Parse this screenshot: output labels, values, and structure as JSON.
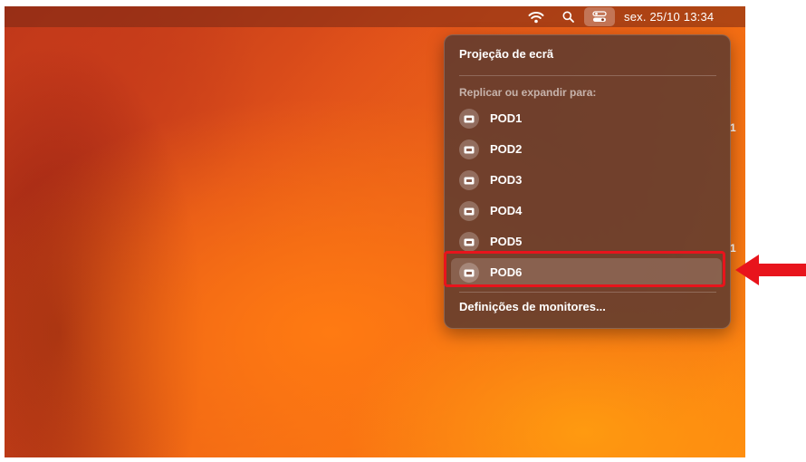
{
  "colors": {
    "annotation": "#e8141c",
    "panel_bg": "#5c3a30",
    "text": "#ffffff"
  },
  "menubar": {
    "icons": [
      "wifi-icon",
      "search-icon",
      "control-center-icon"
    ],
    "clock": "sex. 25/10  13:34"
  },
  "desktop": {
    "edge_digits": [
      "1",
      "1"
    ]
  },
  "screen_mirroring": {
    "title": "Projeção de ecrã",
    "section_label": "Replicar ou expandir para:",
    "devices": [
      {
        "label": "POD1",
        "icon": "apple-tv-icon"
      },
      {
        "label": "POD2",
        "icon": "apple-tv-icon"
      },
      {
        "label": "POD3",
        "icon": "apple-tv-icon"
      },
      {
        "label": "POD4",
        "icon": "apple-tv-icon"
      },
      {
        "label": "POD5",
        "icon": "apple-tv-icon"
      },
      {
        "label": "POD6",
        "icon": "apple-tv-icon",
        "highlighted": true
      }
    ],
    "settings_link": "Definições de monitores..."
  },
  "annotation": {
    "highlighted_item": "POD6",
    "marker": "red-rectangle-and-arrow"
  }
}
